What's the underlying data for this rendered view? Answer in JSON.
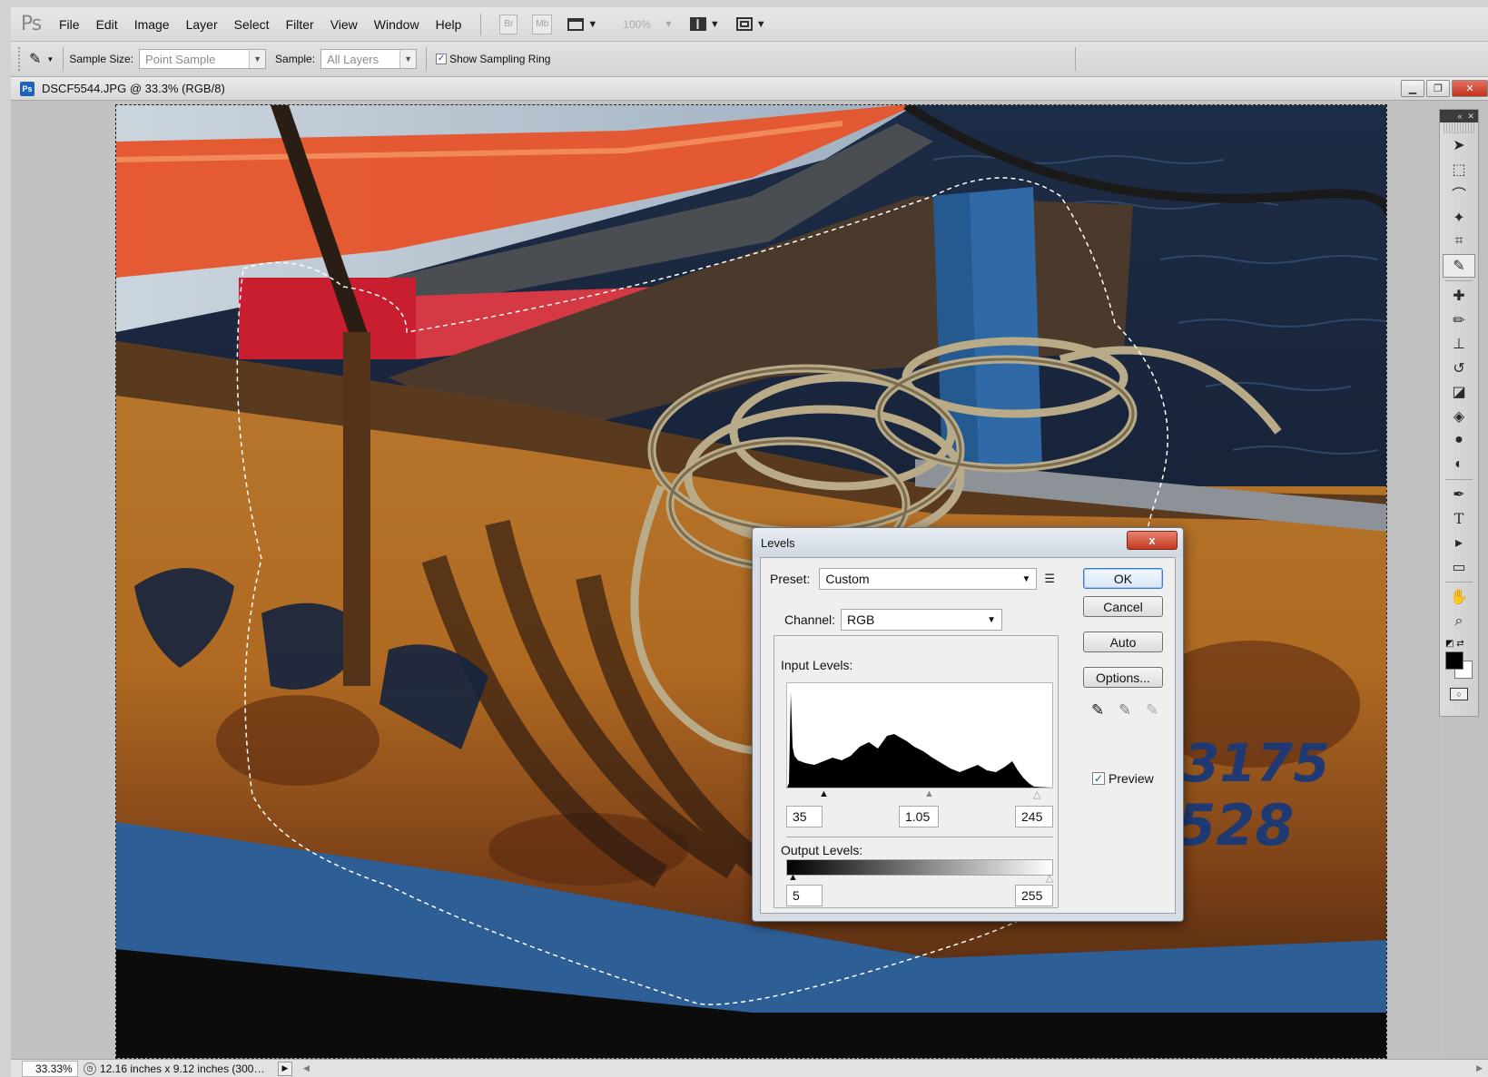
{
  "app": {
    "logo": "Ps",
    "menu": [
      "File",
      "Edit",
      "Image",
      "Layer",
      "Select",
      "Filter",
      "View",
      "Window",
      "Help"
    ],
    "menubar_buttons": {
      "bridge": "Br",
      "mini_bridge": "Mb",
      "zoom": "100%"
    }
  },
  "options_bar": {
    "sample_size_label": "Sample Size:",
    "sample_size_value": "Point Sample",
    "sample_label": "Sample:",
    "sample_value": "All Layers",
    "show_sampling_ring_label": "Show Sampling Ring",
    "show_sampling_ring_checked": "✓"
  },
  "document": {
    "badge": "Ps",
    "title": "DSCF5544.JPG @ 33.3% (RGB/8)",
    "photo_text_top": "3175",
    "photo_text_bottom": "5528"
  },
  "status_bar": {
    "zoom": "33.33%",
    "info": "12.16 inches x 9.12 inches (300…"
  },
  "tools_panel": {
    "icons": [
      "move-icon",
      "marquee-icon",
      "lasso-icon",
      "quick-select-icon",
      "crop-icon",
      "eyedropper-icon",
      "healing-icon",
      "brush-icon",
      "stamp-icon",
      "history-brush-icon",
      "eraser-icon",
      "paint-bucket-icon",
      "blur-icon",
      "dodge-icon",
      "pen-icon",
      "type-icon",
      "path-select-icon",
      "shape-icon",
      "hand-icon",
      "zoom-icon"
    ],
    "foreground": "#000000",
    "background": "#ffffff"
  },
  "levels_dialog": {
    "title": "Levels",
    "close": "x",
    "preset_label": "Preset:",
    "preset_value": "Custom",
    "channel_label": "Channel:",
    "channel_value": "RGB",
    "input_levels_label": "Input Levels:",
    "input_black": "35",
    "input_gamma": "1.05",
    "input_white": "245",
    "output_levels_label": "Output Levels:",
    "output_black": "5",
    "output_white": "255",
    "buttons": {
      "ok": "OK",
      "cancel": "Cancel",
      "auto": "Auto",
      "options": "Options..."
    },
    "preview_label": "Preview",
    "preview_checked": "✓"
  }
}
